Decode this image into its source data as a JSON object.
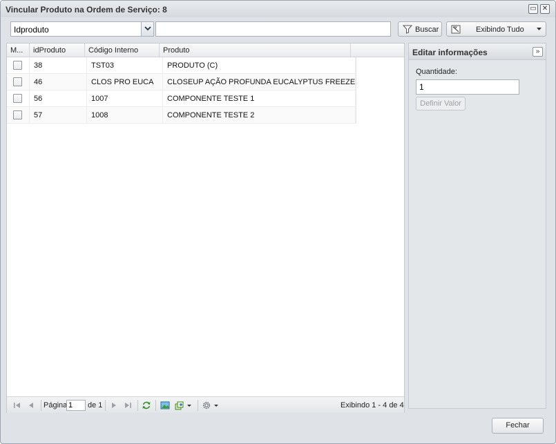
{
  "window": {
    "title": "Vincular Produto na Ordem de Serviço: 8",
    "restore_icon": "restore-icon",
    "close_icon": "close-icon"
  },
  "toolbar": {
    "field_select": "Idproduto",
    "search_value": "",
    "buscar_label": "Buscar",
    "filter_label": "Exibindo Tudo"
  },
  "grid": {
    "columns": [
      "M...",
      "idProduto",
      "Código Interno",
      "Produto"
    ],
    "rows": [
      {
        "id": "38",
        "codigo": "TST03",
        "produto": "PRODUTO (C)"
      },
      {
        "id": "46",
        "codigo": "CLOS PRO EUCA",
        "produto": "CLOSEUP AÇÃO PROFUNDA EUCALYPTUS FREEZE"
      },
      {
        "id": "56",
        "codigo": "1007",
        "produto": "COMPONENTE TESTE 1"
      },
      {
        "id": "57",
        "codigo": "1008",
        "produto": "COMPONENTE TESTE 2"
      }
    ]
  },
  "pager": {
    "page_label": "Página",
    "page_value": "1",
    "of_label": "de 1",
    "display_info": "Exibindo 1 - 4 de 4"
  },
  "side": {
    "title": "Editar informações",
    "quantity_label": "Quantidade:",
    "quantity_value": "1",
    "define_label": "Definir Valor"
  },
  "footer": {
    "close_label": "Fechar"
  }
}
